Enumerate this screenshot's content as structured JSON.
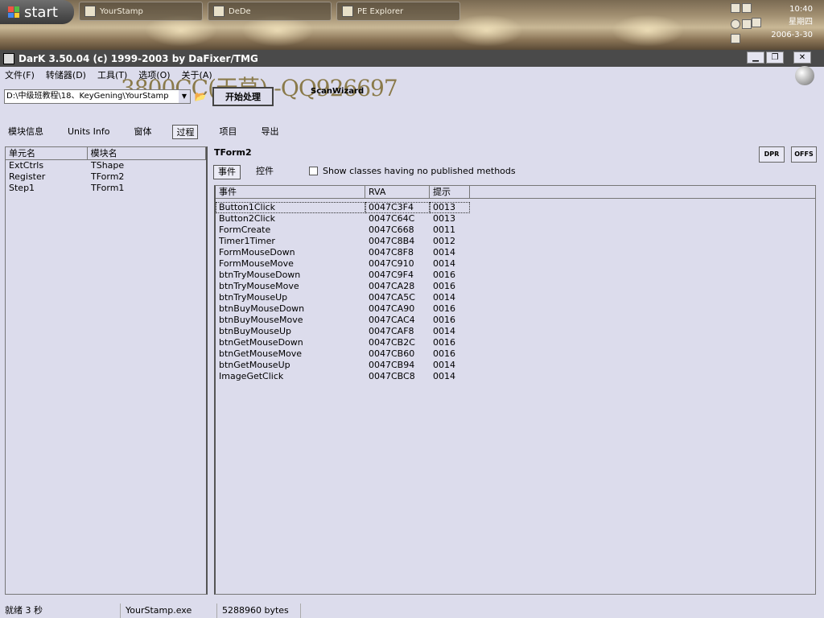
{
  "taskbar": {
    "start_label": "start",
    "tasks": [
      {
        "label": "YourStamp"
      },
      {
        "label": "DeDe"
      },
      {
        "label": "PE Explorer"
      }
    ],
    "clock": {
      "time": "10:40",
      "day": "星期四",
      "date": "2006-3-30"
    }
  },
  "window": {
    "title": "DarK 3.50.04 (c) 1999-2003 by DaFixer/TMG",
    "min_glyph": "▁",
    "max_glyph": "❐",
    "close_glyph": "✕"
  },
  "menu": {
    "items": [
      {
        "label": "文件(F)"
      },
      {
        "label": "转储器(D)"
      },
      {
        "label": "工具(T)"
      },
      {
        "label": "选项(O)"
      },
      {
        "label": "关于(A)"
      }
    ]
  },
  "watermark": "3800CC(天草)--QQ926697",
  "toolbar": {
    "path_value": "D:\\中级班教程\\18、KeyGening\\YourStamp",
    "folder_glyph": "📂",
    "process_label": "开始处理",
    "scanwizard_label": "ScanWizard"
  },
  "main_tabs": [
    {
      "label": "模块信息"
    },
    {
      "label": "Units Info"
    },
    {
      "label": "窗体"
    },
    {
      "label": "过程"
    },
    {
      "label": "项目"
    },
    {
      "label": "导出"
    }
  ],
  "units": {
    "headers": [
      "单元名",
      "模块名"
    ],
    "rows": [
      {
        "unit": "ExtCtrls",
        "module": "TShape"
      },
      {
        "unit": "Register",
        "module": "TForm2"
      },
      {
        "unit": "Step1",
        "module": "TForm1"
      }
    ]
  },
  "form_panel": {
    "title": "TForm2",
    "dpr_label": "DPR",
    "offs_label": "OFFS",
    "sub_tabs": [
      {
        "label": "事件"
      },
      {
        "label": "控件"
      }
    ],
    "show_classes_label": "Show classes having no published methods",
    "headers": [
      "事件",
      "RVA",
      "提示"
    ],
    "events": [
      {
        "name": "Button1Click",
        "rva": "0047C3F4",
        "hint": "0013"
      },
      {
        "name": "Button2Click",
        "rva": "0047C64C",
        "hint": "0013"
      },
      {
        "name": "FormCreate",
        "rva": "0047C668",
        "hint": "0011"
      },
      {
        "name": "Timer1Timer",
        "rva": "0047C8B4",
        "hint": "0012"
      },
      {
        "name": "FormMouseDown",
        "rva": "0047C8F8",
        "hint": "0014"
      },
      {
        "name": "FormMouseMove",
        "rva": "0047C910",
        "hint": "0014"
      },
      {
        "name": "btnTryMouseDown",
        "rva": "0047C9F4",
        "hint": "0016"
      },
      {
        "name": "btnTryMouseMove",
        "rva": "0047CA28",
        "hint": "0016"
      },
      {
        "name": "btnTryMouseUp",
        "rva": "0047CA5C",
        "hint": "0014"
      },
      {
        "name": "btnBuyMouseDown",
        "rva": "0047CA90",
        "hint": "0016"
      },
      {
        "name": "btnBuyMouseMove",
        "rva": "0047CAC4",
        "hint": "0016"
      },
      {
        "name": "btnBuyMouseUp",
        "rva": "0047CAF8",
        "hint": "0014"
      },
      {
        "name": "btnGetMouseDown",
        "rva": "0047CB2C",
        "hint": "0016"
      },
      {
        "name": "btnGetMouseMove",
        "rva": "0047CB60",
        "hint": "0016"
      },
      {
        "name": "btnGetMouseUp",
        "rva": "0047CB94",
        "hint": "0014"
      },
      {
        "name": "ImageGetClick",
        "rva": "0047CBC8",
        "hint": "0014"
      }
    ]
  },
  "status": {
    "ready": "就绪 3 秒",
    "file": "YourStamp.exe",
    "size": "5288960 bytes"
  }
}
